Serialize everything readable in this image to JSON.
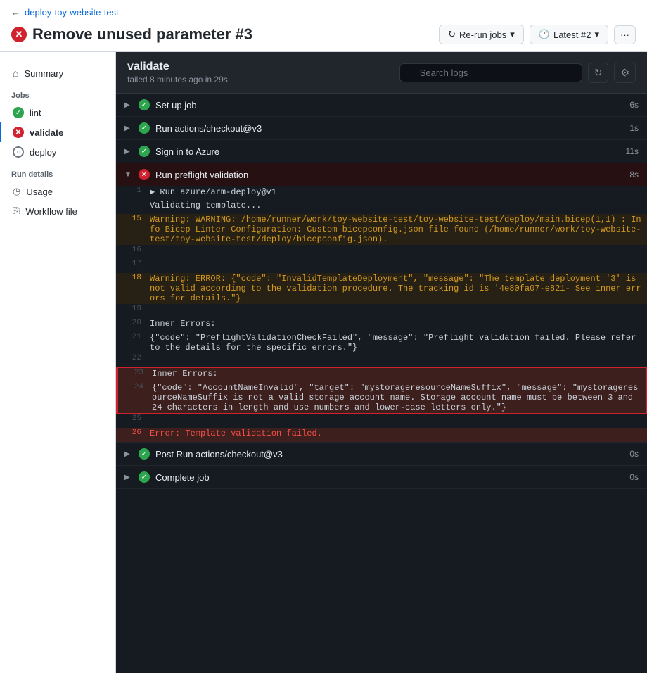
{
  "breadcrumb": {
    "back": "←",
    "link": "deploy-toy-website-test"
  },
  "title": "Remove unused parameter #3",
  "buttons": {
    "rerun": "Re-run jobs",
    "latest": "Latest #2",
    "more": "···"
  },
  "sidebar": {
    "summary": "Summary",
    "jobs_label": "Jobs",
    "jobs": [
      {
        "name": "lint",
        "status": "success"
      },
      {
        "name": "validate",
        "status": "error",
        "active": true
      },
      {
        "name": "deploy",
        "status": "neutral"
      }
    ],
    "run_details_label": "Run details",
    "run_details": [
      {
        "name": "Usage",
        "icon": "clock"
      },
      {
        "name": "Workflow file",
        "icon": "file"
      }
    ]
  },
  "job": {
    "title": "validate",
    "subtitle": "failed 8 minutes ago in 29s",
    "search_placeholder": "Search logs"
  },
  "steps": [
    {
      "id": "setup",
      "title": "Set up job",
      "status": "success",
      "expanded": false,
      "duration": "6s"
    },
    {
      "id": "checkout",
      "title": "Run actions/checkout@v3",
      "status": "success",
      "expanded": false,
      "duration": "1s"
    },
    {
      "id": "signin",
      "title": "Sign in to Azure",
      "status": "success",
      "expanded": false,
      "duration": "11s"
    },
    {
      "id": "preflight",
      "title": "Run preflight validation",
      "status": "error",
      "expanded": true,
      "duration": "8s"
    }
  ],
  "log_lines": [
    {
      "num": "1",
      "content": "▶ Run azure/arm-deploy@v1",
      "type": "normal"
    },
    {
      "num": "",
      "content": "Validating template...",
      "type": "normal"
    },
    {
      "num": "15",
      "content": "Warning: WARNING: /home/runner/work/toy-website-test/toy-website-test/deploy/main.bicep(1,1) : Info Bicep Linter Configuration: Custom bicepconfig.json file found (/home/runner/work/toy-website-test/toy-website-test/deploy/bicepconfig.json).",
      "type": "warning"
    },
    {
      "num": "16",
      "content": "",
      "type": "normal"
    },
    {
      "num": "17",
      "content": "",
      "type": "normal"
    },
    {
      "num": "18",
      "content": "Warning: ERROR: {\"code\": \"InvalidTemplateDeployment\", \"message\": \"The template deployment '3' is not valid according to the validation procedure. The tracking id is '4e80fa07-e821- See inner errors for details.\"}",
      "type": "warning"
    },
    {
      "num": "19",
      "content": "",
      "type": "normal"
    },
    {
      "num": "20",
      "content": "Inner Errors:",
      "type": "normal"
    },
    {
      "num": "21",
      "content": "{\"code\": \"PreflightValidationCheckFailed\", \"message\": \"Preflight validation failed. Please refer to the details for the specific errors.\"}",
      "type": "normal"
    },
    {
      "num": "22",
      "content": "",
      "type": "normal"
    },
    {
      "num": "23",
      "content": "Inner Errors:",
      "type": "highlight"
    },
    {
      "num": "24",
      "content": "{\"code\": \"AccountNameInvalid\", \"target\": \"mystorageresourceNameSuffix\", \"message\": \"mystorageresourceNameSuffix is not a valid storage account name. Storage account name must be between 3 and 24 characters in length and use numbers and lower-case letters only.\"}",
      "type": "highlight"
    },
    {
      "num": "25",
      "content": "",
      "type": "normal"
    },
    {
      "num": "26",
      "content": "Error: Template validation failed.",
      "type": "error"
    }
  ],
  "post_steps": [
    {
      "id": "post-checkout",
      "title": "Post Run actions/checkout@v3",
      "status": "success",
      "duration": "0s"
    },
    {
      "id": "complete",
      "title": "Complete job",
      "status": "success",
      "duration": "0s"
    }
  ]
}
